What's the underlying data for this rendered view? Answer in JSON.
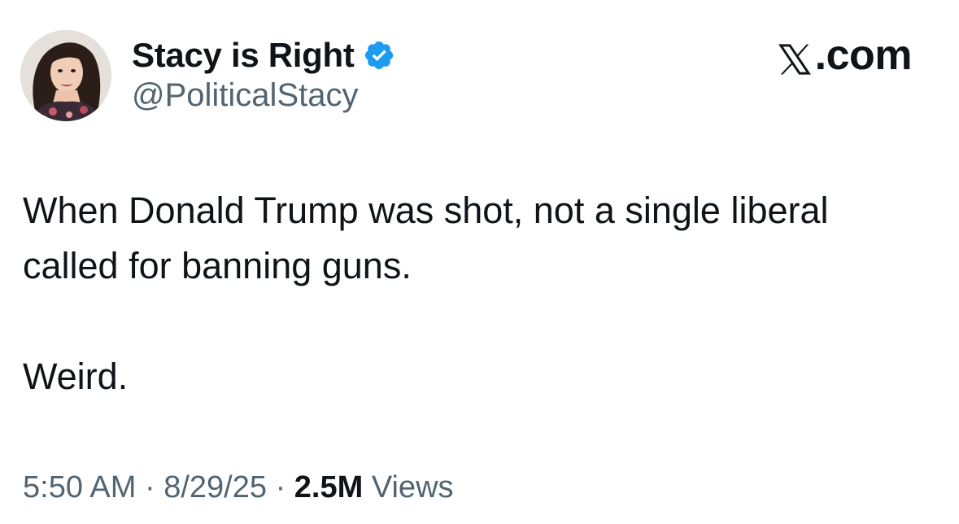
{
  "author": {
    "display_name": "Stacy is Right",
    "handle": "@PoliticalStacy",
    "verified": true,
    "verified_color": "#1d9bf0",
    "avatar_icon": "profile-photo"
  },
  "brand": {
    "suffix": ".com",
    "logo_icon": "x-logo-icon"
  },
  "tweet": {
    "lines": [
      "When Donald Trump was shot, not a single liberal",
      "called for banning guns."
    ],
    "closing": "Weird."
  },
  "meta": {
    "time": "5:50 AM",
    "separator": "·",
    "date": "8/29/25",
    "views_count": "2.5M",
    "views_label": "Views"
  },
  "colors": {
    "text_primary": "#0f1419",
    "text_secondary": "#536471",
    "background": "#ffffff"
  }
}
